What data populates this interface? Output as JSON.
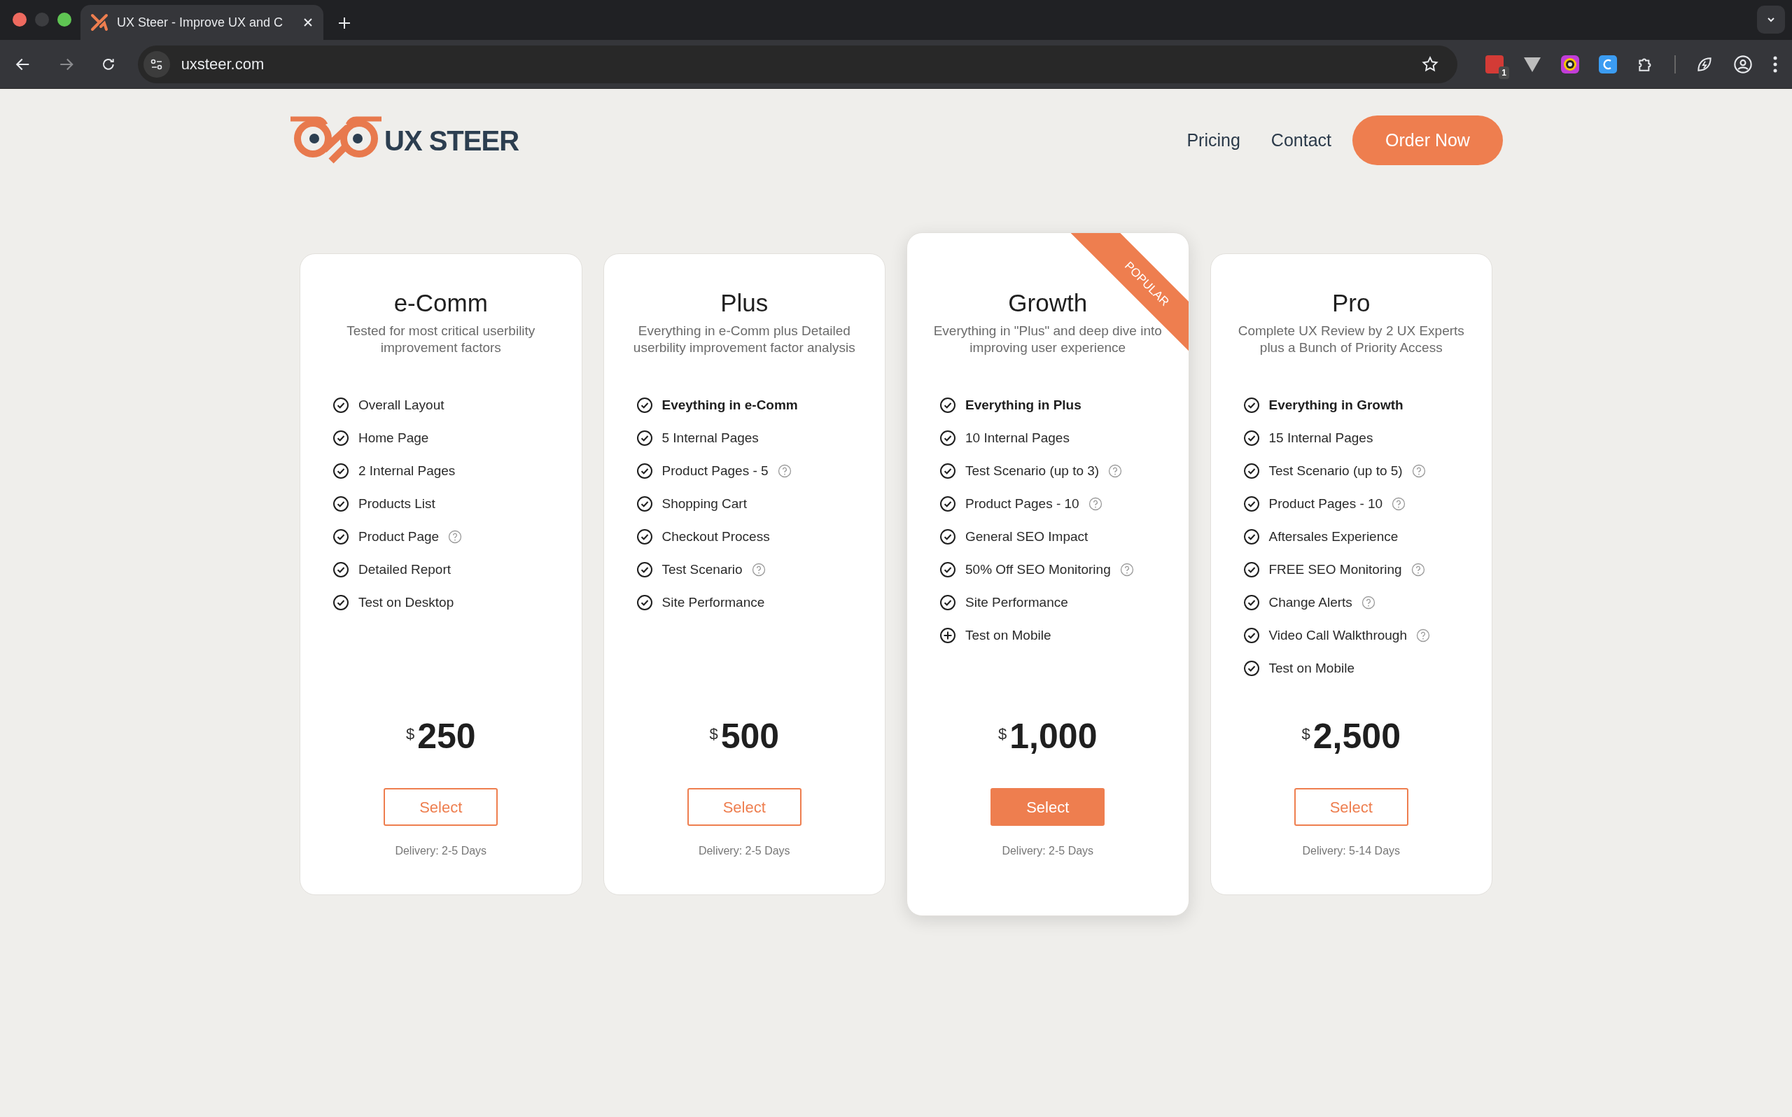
{
  "browser": {
    "tab_title": "UX Steer - Improve UX and C",
    "url": "uxsteer.com",
    "extension_badge": "1"
  },
  "header": {
    "logo_text": "UX STEER",
    "nav": [
      {
        "label": "Pricing"
      },
      {
        "label": "Contact"
      }
    ],
    "cta": "Order Now"
  },
  "plans": [
    {
      "name": "e-Comm",
      "description": "Tested for most critical userbility improvement factors",
      "highlighted": false,
      "currency": "$",
      "price": "250",
      "button": "Select",
      "delivery": "Delivery: 2-5 Days",
      "features": [
        {
          "text": "Overall Layout",
          "kind": "check",
          "bold": false,
          "info": false
        },
        {
          "text": "Home Page",
          "kind": "check",
          "bold": false,
          "info": false
        },
        {
          "text": "2 Internal Pages",
          "kind": "check",
          "bold": false,
          "info": false
        },
        {
          "text": "Products List",
          "kind": "check",
          "bold": false,
          "info": false
        },
        {
          "text": "Product Page",
          "kind": "check",
          "bold": false,
          "info": true
        },
        {
          "text": "Detailed Report",
          "kind": "check",
          "bold": false,
          "info": false
        },
        {
          "text": "Test on Desktop",
          "kind": "check",
          "bold": false,
          "info": false
        }
      ]
    },
    {
      "name": "Plus",
      "description": "Everything in e-Comm plus Detailed userbility improvement factor analysis",
      "highlighted": false,
      "currency": "$",
      "price": "500",
      "button": "Select",
      "delivery": "Delivery: 2-5 Days",
      "features": [
        {
          "text": "Eveything in e-Comm",
          "kind": "check",
          "bold": true,
          "info": false
        },
        {
          "text": "5 Internal Pages",
          "kind": "check",
          "bold": false,
          "info": false
        },
        {
          "text": "Product Pages - 5",
          "kind": "check",
          "bold": false,
          "info": true
        },
        {
          "text": "Shopping Cart",
          "kind": "check",
          "bold": false,
          "info": false
        },
        {
          "text": "Checkout Process",
          "kind": "check",
          "bold": false,
          "info": false
        },
        {
          "text": "Test Scenario",
          "kind": "check",
          "bold": false,
          "info": true
        },
        {
          "text": "Site Performance",
          "kind": "check",
          "bold": false,
          "info": false
        }
      ]
    },
    {
      "name": "Growth",
      "description": "Everything in \"Plus\" and deep dive into improving user experience",
      "highlighted": true,
      "ribbon": "POPULAR",
      "currency": "$",
      "price": "1,000",
      "button": "Select",
      "delivery": "Delivery: 2-5 Days",
      "features": [
        {
          "text": "Everything in Plus",
          "kind": "check",
          "bold": true,
          "info": false
        },
        {
          "text": "10 Internal Pages",
          "kind": "check",
          "bold": false,
          "info": false
        },
        {
          "text": "Test Scenario (up to 3)",
          "kind": "check",
          "bold": false,
          "info": true
        },
        {
          "text": "Product Pages - 10",
          "kind": "check",
          "bold": false,
          "info": true
        },
        {
          "text": "General SEO Impact",
          "kind": "check",
          "bold": false,
          "info": false
        },
        {
          "text": "50% Off SEO Monitoring",
          "kind": "check",
          "bold": false,
          "info": true
        },
        {
          "text": "Site Performance",
          "kind": "check",
          "bold": false,
          "info": false
        },
        {
          "text": "Test on Mobile",
          "kind": "plus",
          "bold": false,
          "info": false
        }
      ]
    },
    {
      "name": "Pro",
      "description": "Complete UX Review by 2 UX Experts plus a Bunch of Priority Access",
      "highlighted": false,
      "currency": "$",
      "price": "2,500",
      "button": "Select",
      "delivery": "Delivery: 5-14 Days",
      "features": [
        {
          "text": "Everything in Growth",
          "kind": "check",
          "bold": true,
          "info": false
        },
        {
          "text": "15 Internal Pages",
          "kind": "check",
          "bold": false,
          "info": false
        },
        {
          "text": "Test Scenario (up to 5)",
          "kind": "check",
          "bold": false,
          "info": true
        },
        {
          "text": "Product Pages - 10",
          "kind": "check",
          "bold": false,
          "info": true
        },
        {
          "text": "Aftersales Experience",
          "kind": "check",
          "bold": false,
          "info": false
        },
        {
          "text": "FREE SEO Monitoring",
          "kind": "check",
          "bold": false,
          "info": true
        },
        {
          "text": "Change Alerts",
          "kind": "check",
          "bold": false,
          "info": true
        },
        {
          "text": "Video Call Walkthrough",
          "kind": "check",
          "bold": false,
          "info": true
        },
        {
          "text": "Test on Mobile",
          "kind": "check",
          "bold": false,
          "info": false
        }
      ]
    }
  ]
}
